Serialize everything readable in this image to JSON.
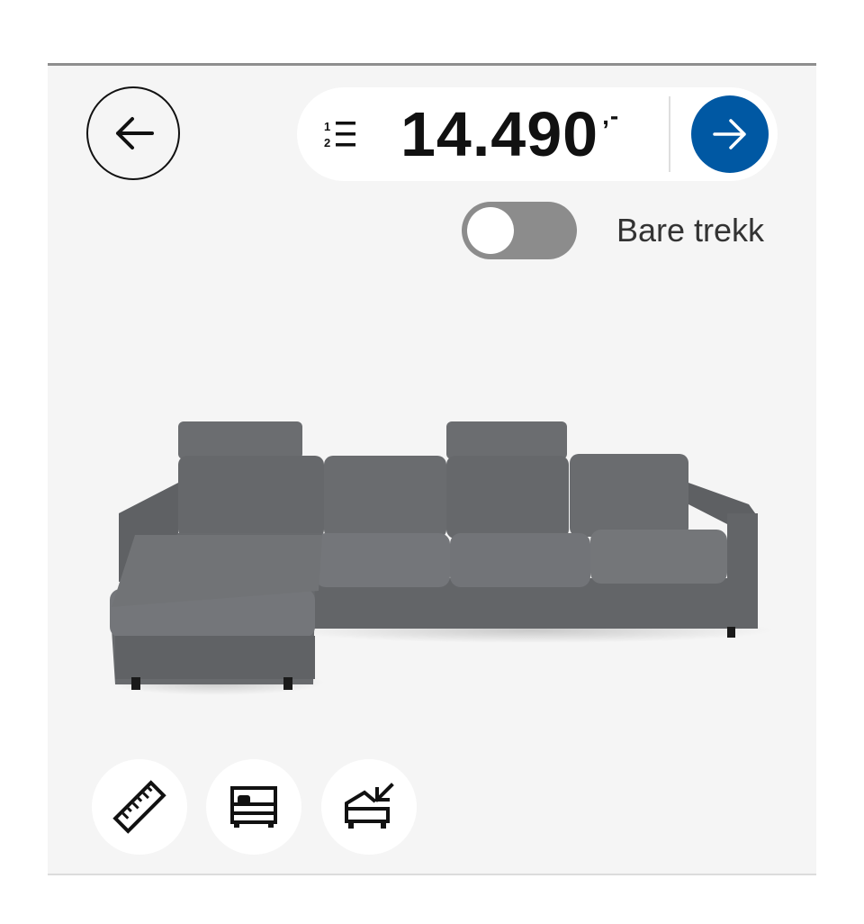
{
  "header": {
    "back_icon": "arrow-left-icon",
    "list_icon": "numbered-list-icon",
    "price": "14.490",
    "price_suffix": ",-",
    "go_icon": "arrow-right-icon",
    "accent": "#0058a3"
  },
  "toggle": {
    "label": "Bare trekk",
    "on": false
  },
  "product_image": "grey-corner-sofa-with-chaise",
  "tools": [
    {
      "icon": "ruler-icon"
    },
    {
      "icon": "sofa-bed-icon"
    },
    {
      "icon": "storage-chaise-icon"
    }
  ]
}
